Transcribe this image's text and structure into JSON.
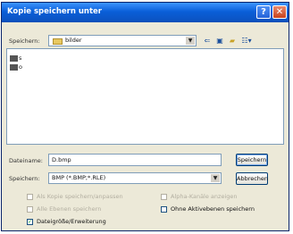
{
  "window": {
    "title": "Kopie speichern unter",
    "help_glyph": "?",
    "close_glyph": "✕"
  },
  "save_in": {
    "label": "Speichern:",
    "value": "bilder"
  },
  "toolbar_icons": [
    "back-icon",
    "up-folder-icon",
    "new-folder-icon",
    "view-menu-icon"
  ],
  "files": [
    "s",
    "o"
  ],
  "filename": {
    "label": "Dateiname:",
    "value": "D.bmp"
  },
  "format": {
    "label": "Speichern:",
    "value": "BMP (*.BMP;*.RLE)"
  },
  "buttons": {
    "save": "Speichern",
    "cancel": "Abbrechen"
  },
  "options": {
    "opt1": "Als Kopie speichern/anpassen",
    "opt2": "Alle Ebenen speichern",
    "opt3": "Alpha-Kanäle anzeigen",
    "opt4": "Ohne Aktivebenen speichern",
    "opt5": "Dateigröße/Erweiterung"
  }
}
